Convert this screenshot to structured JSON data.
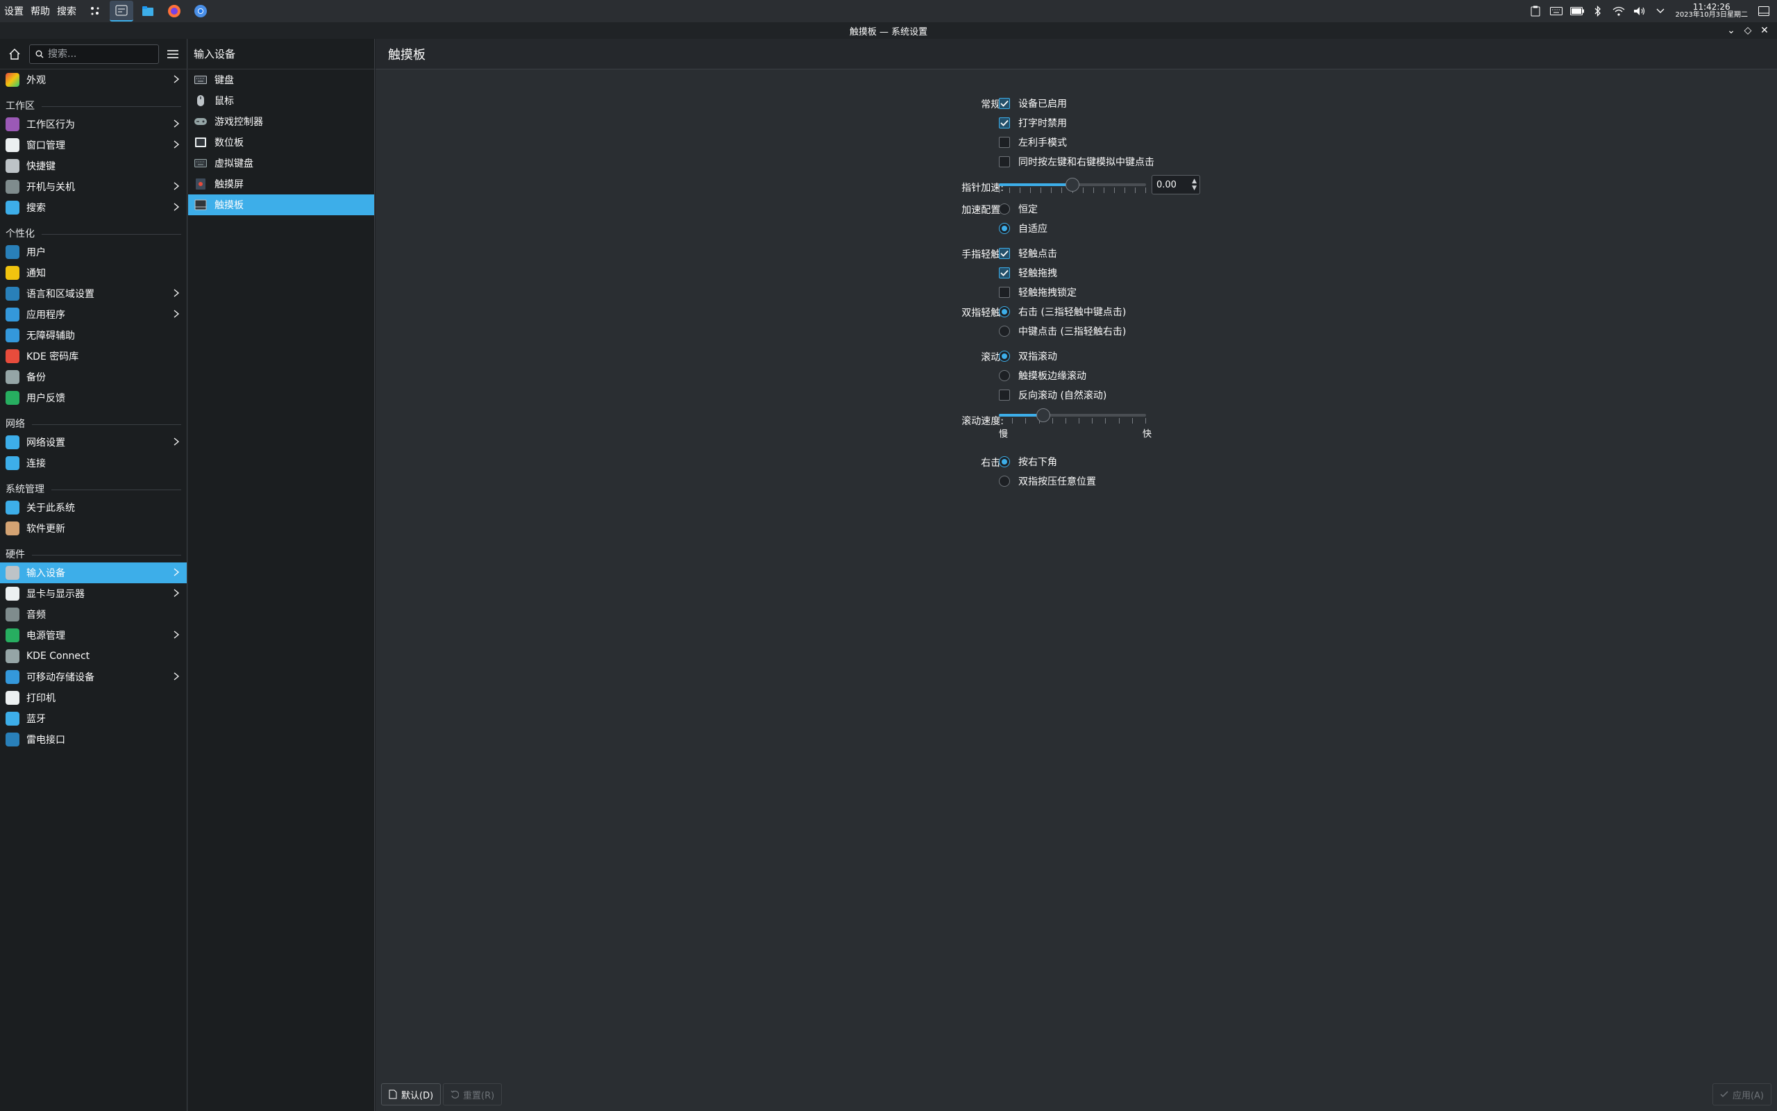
{
  "panel": {
    "menu": [
      "设置",
      "帮助",
      "搜索"
    ],
    "clock_time": "11:42:26",
    "clock_date": "2023年10月3日星期二",
    "tray_icons": [
      "clipboard-icon",
      "keyboard-icon",
      "battery-icon",
      "bluetooth-icon",
      "wifi-icon",
      "volume-icon",
      "expand-icon"
    ]
  },
  "window": {
    "title": "触摸板 — 系统设置"
  },
  "sidebar": {
    "search_placeholder": "搜索...",
    "top_item": {
      "label": "外观",
      "color": "#e04b4b"
    },
    "categories": [
      {
        "title": "工作区",
        "items": [
          {
            "label": "工作区行为",
            "chev": true,
            "color": "#9b59b6"
          },
          {
            "label": "窗口管理",
            "chev": true,
            "color": "#ecf0f1"
          },
          {
            "label": "快捷键",
            "chev": false,
            "color": "#bdc3c7"
          },
          {
            "label": "开机与关机",
            "chev": true,
            "color": "#7f8c8d"
          },
          {
            "label": "搜索",
            "chev": true,
            "color": "#3daee9"
          }
        ]
      },
      {
        "title": "个性化",
        "items": [
          {
            "label": "用户",
            "chev": false,
            "color": "#2980b9"
          },
          {
            "label": "通知",
            "chev": false,
            "color": "#f1c40f"
          },
          {
            "label": "语言和区域设置",
            "chev": true,
            "color": "#2980b9"
          },
          {
            "label": "应用程序",
            "chev": true,
            "color": "#3498db"
          },
          {
            "label": "无障碍辅助",
            "chev": false,
            "color": "#3498db"
          },
          {
            "label": "KDE 密码库",
            "chev": false,
            "color": "#e74c3c"
          },
          {
            "label": "备份",
            "chev": false,
            "color": "#95a5a6"
          },
          {
            "label": "用户反馈",
            "chev": false,
            "color": "#27ae60"
          }
        ]
      },
      {
        "title": "网络",
        "items": [
          {
            "label": "网络设置",
            "chev": true,
            "color": "#3daee9"
          },
          {
            "label": "连接",
            "chev": false,
            "color": "#3daee9"
          }
        ]
      },
      {
        "title": "系统管理",
        "items": [
          {
            "label": "关于此系统",
            "chev": false,
            "color": "#3daee9"
          },
          {
            "label": "软件更新",
            "chev": false,
            "color": "#d4a373"
          }
        ]
      },
      {
        "title": "硬件",
        "items": [
          {
            "label": "输入设备",
            "chev": true,
            "color": "#bdc3c7",
            "selected": true
          },
          {
            "label": "显卡与显示器",
            "chev": true,
            "color": "#ecf0f1"
          },
          {
            "label": "音频",
            "chev": false,
            "color": "#7f8c8d"
          },
          {
            "label": "电源管理",
            "chev": true,
            "color": "#27ae60"
          },
          {
            "label": "KDE Connect",
            "chev": false,
            "color": "#95a5a6"
          },
          {
            "label": "可移动存储设备",
            "chev": true,
            "color": "#3498db"
          },
          {
            "label": "打印机",
            "chev": false,
            "color": "#ecf0f1"
          },
          {
            "label": "蓝牙",
            "chev": false,
            "color": "#3daee9"
          },
          {
            "label": "雷电接口",
            "chev": false,
            "color": "#2980b9"
          }
        ]
      }
    ]
  },
  "subpanel": {
    "title": "输入设备",
    "items": [
      {
        "label": "键盘",
        "icon": "keyboard-icon"
      },
      {
        "label": "鼠标",
        "icon": "mouse-icon"
      },
      {
        "label": "游戏控制器",
        "icon": "gamepad-icon"
      },
      {
        "label": "数位板",
        "icon": "tablet-icon"
      },
      {
        "label": "虚拟键盘",
        "icon": "virtual-keyboard-icon"
      },
      {
        "label": "触摸屏",
        "icon": "touchscreen-icon"
      },
      {
        "label": "触摸板",
        "icon": "touchpad-icon",
        "selected": true
      }
    ]
  },
  "main": {
    "title": "触摸板",
    "general_label": "常规:",
    "general": [
      {
        "text": "设备已启用",
        "checked": true
      },
      {
        "text": "打字时禁用",
        "checked": true
      },
      {
        "text": "左利手模式",
        "checked": false
      },
      {
        "text": "同时按左键和右键模拟中键点击",
        "checked": false
      }
    ],
    "pointer_accel_label": "指针加速:",
    "pointer_accel_value": "0.00",
    "pointer_accel_fraction": 0.5,
    "accel_profile_label": "加速配置:",
    "accel_profile": [
      {
        "text": "恒定",
        "checked": false
      },
      {
        "text": "自适应",
        "checked": true
      }
    ],
    "tapping_label": "手指轻触:",
    "tapping": [
      {
        "text": "轻触点击",
        "checked": true
      },
      {
        "text": "轻触拖拽",
        "checked": true
      },
      {
        "text": "轻触拖拽锁定",
        "checked": false
      }
    ],
    "two_finger_label": "双指轻触:",
    "two_finger": [
      {
        "text": "右击 (三指轻触中键点击)",
        "checked": true
      },
      {
        "text": "中键点击 (三指轻触右击)",
        "checked": false
      }
    ],
    "scrolling_label": "滚动:",
    "scrolling": [
      {
        "text": "双指滚动",
        "checked": true,
        "type": "radio"
      },
      {
        "text": "触摸板边缘滚动",
        "checked": false,
        "type": "radio"
      },
      {
        "text": "反向滚动 (自然滚动)",
        "checked": false,
        "type": "checkbox"
      }
    ],
    "scroll_speed_label": "滚动速度:",
    "scroll_speed_fraction": 0.3,
    "scroll_slow": "慢",
    "scroll_fast": "快",
    "right_click_label": "右击:",
    "right_click": [
      {
        "text": "按右下角",
        "checked": true
      },
      {
        "text": "双指按压任意位置",
        "checked": false
      }
    ]
  },
  "footer": {
    "defaults_label": "默认(D)",
    "reset_label": "重置(R)",
    "apply_label": "应用(A)"
  }
}
